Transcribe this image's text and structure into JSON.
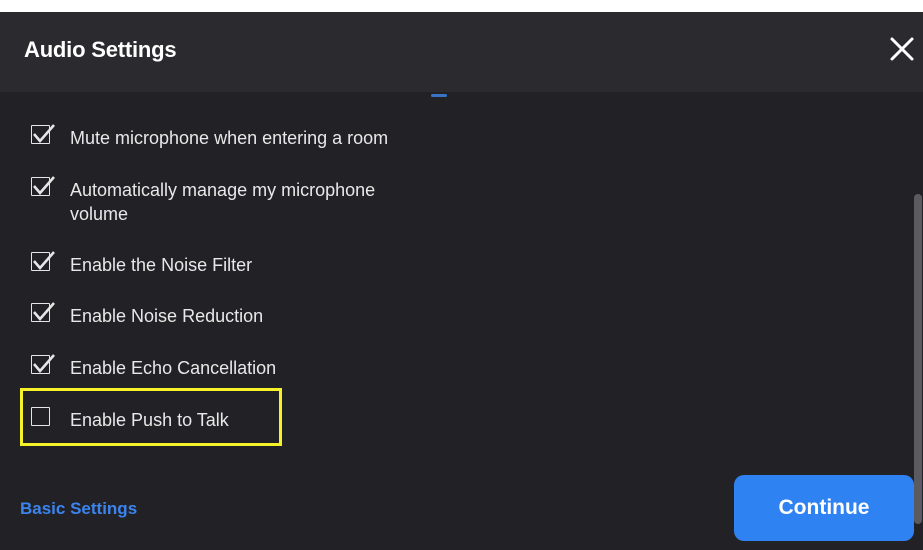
{
  "dialog": {
    "title": "Audio Settings",
    "close_icon": "close-icon"
  },
  "options": [
    {
      "label": "Mute microphone when entering a room",
      "checked": true
    },
    {
      "label": "Automatically manage my microphone volume",
      "checked": true
    },
    {
      "label": "Enable the Noise Filter",
      "checked": true
    },
    {
      "label": "Enable Noise Reduction",
      "checked": true
    },
    {
      "label": "Enable Echo Cancellation",
      "checked": true
    },
    {
      "label": "Enable Push to Talk",
      "checked": false
    }
  ],
  "footer": {
    "basic_settings_label": "Basic Settings",
    "continue_label": "Continue"
  },
  "colors": {
    "background": "#222226",
    "header": "#2a2a2f",
    "accent": "#2f82f2",
    "link": "#3b84ee",
    "highlight": "#f5f22a"
  }
}
